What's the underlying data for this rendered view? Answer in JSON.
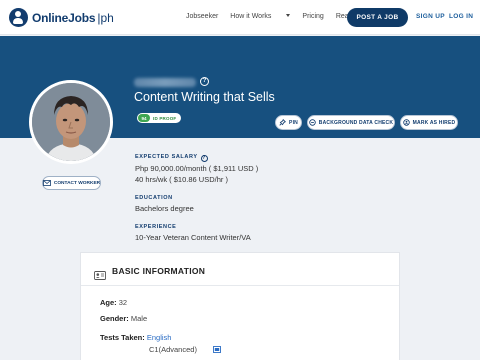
{
  "nav": {
    "logo_text": "OnlineJobs",
    "logo_suffix": "ph",
    "links": [
      "Jobseeker",
      "How it Works",
      "Pricing",
      "Real Results"
    ],
    "post_job": "POST A JOB",
    "sign_up": "SIGN UP",
    "log_in": "LOG IN"
  },
  "profile": {
    "title": "Content Writing that Sells",
    "id_score": "94",
    "id_label": "ID PROOF",
    "actions": {
      "pin": "PIN",
      "background_check": "BACKGROUND DATA CHECK",
      "mark_hired": "MARK AS HIRED"
    },
    "contact": "CONTACT WORKER"
  },
  "details": {
    "salary_label": "EXPECTED SALARY",
    "salary_monthly": "Php 90,000.00/month ( $1,911 USD )",
    "salary_hourly": "40 hrs/wk ( $10.86 USD/hr )",
    "education_label": "EDUCATION",
    "education_value": "Bachelors degree",
    "experience_label": "EXPERIENCE",
    "experience_value": "10-Year Veteran Content Writer/VA"
  },
  "basic_info": {
    "title": "BASIC INFORMATION",
    "age_label": "Age:",
    "age": "32",
    "gender_label": "Gender:",
    "gender": "Male",
    "tests_label": "Tests Taken:",
    "test_name": "English",
    "test_level": "C1(Advanced)"
  },
  "colors": {
    "brand": "#123c6e",
    "hero": "#17507f",
    "id_badge": "#3fa651",
    "link": "#2a6cc4"
  }
}
